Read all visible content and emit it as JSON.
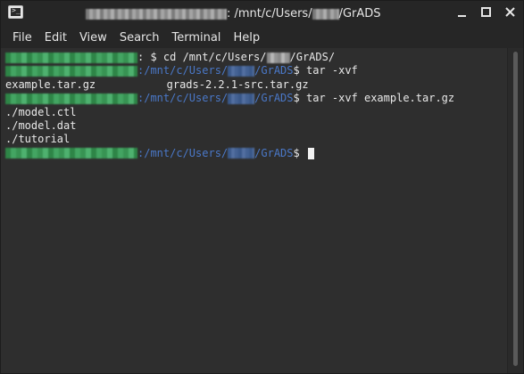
{
  "window": {
    "title_suffix": ": /mnt/c/Users/",
    "title_end": "/GrADS",
    "controls": [
      "minimize",
      "maximize",
      "close"
    ]
  },
  "menu": [
    "File",
    "Edit",
    "View",
    "Search",
    "Terminal",
    "Help"
  ],
  "terminal": {
    "lines": [
      {
        "kind": "cmd_home",
        "text": ": $ cd /mnt/c/Users/",
        "text2": "/GrADS/"
      },
      {
        "kind": "prompt_path",
        "path": ":/mnt/c/Users/",
        "path2": "/GrADS",
        "cmd": "$ tar -xvf"
      },
      {
        "kind": "output",
        "text": "example.tar.gz           grads-2.2.1-src.tar.gz"
      },
      {
        "kind": "prompt_path",
        "path": ":/mnt/c/Users/",
        "path2": "/GrADS",
        "cmd": "$ tar -xvf example.tar.gz"
      },
      {
        "kind": "output",
        "text": "./model.ctl"
      },
      {
        "kind": "output",
        "text": "./model.dat"
      },
      {
        "kind": "output",
        "text": "./tutorial"
      },
      {
        "kind": "prompt_path_cursor",
        "path": ":/mnt/c/Users/",
        "path2": "/GrADS",
        "cmd": "$ "
      }
    ]
  },
  "colors": {
    "background": "#2e2e2e",
    "text": "#e8e8e8",
    "path": "#4a78c8",
    "user_host_redacted": "#46b268"
  }
}
